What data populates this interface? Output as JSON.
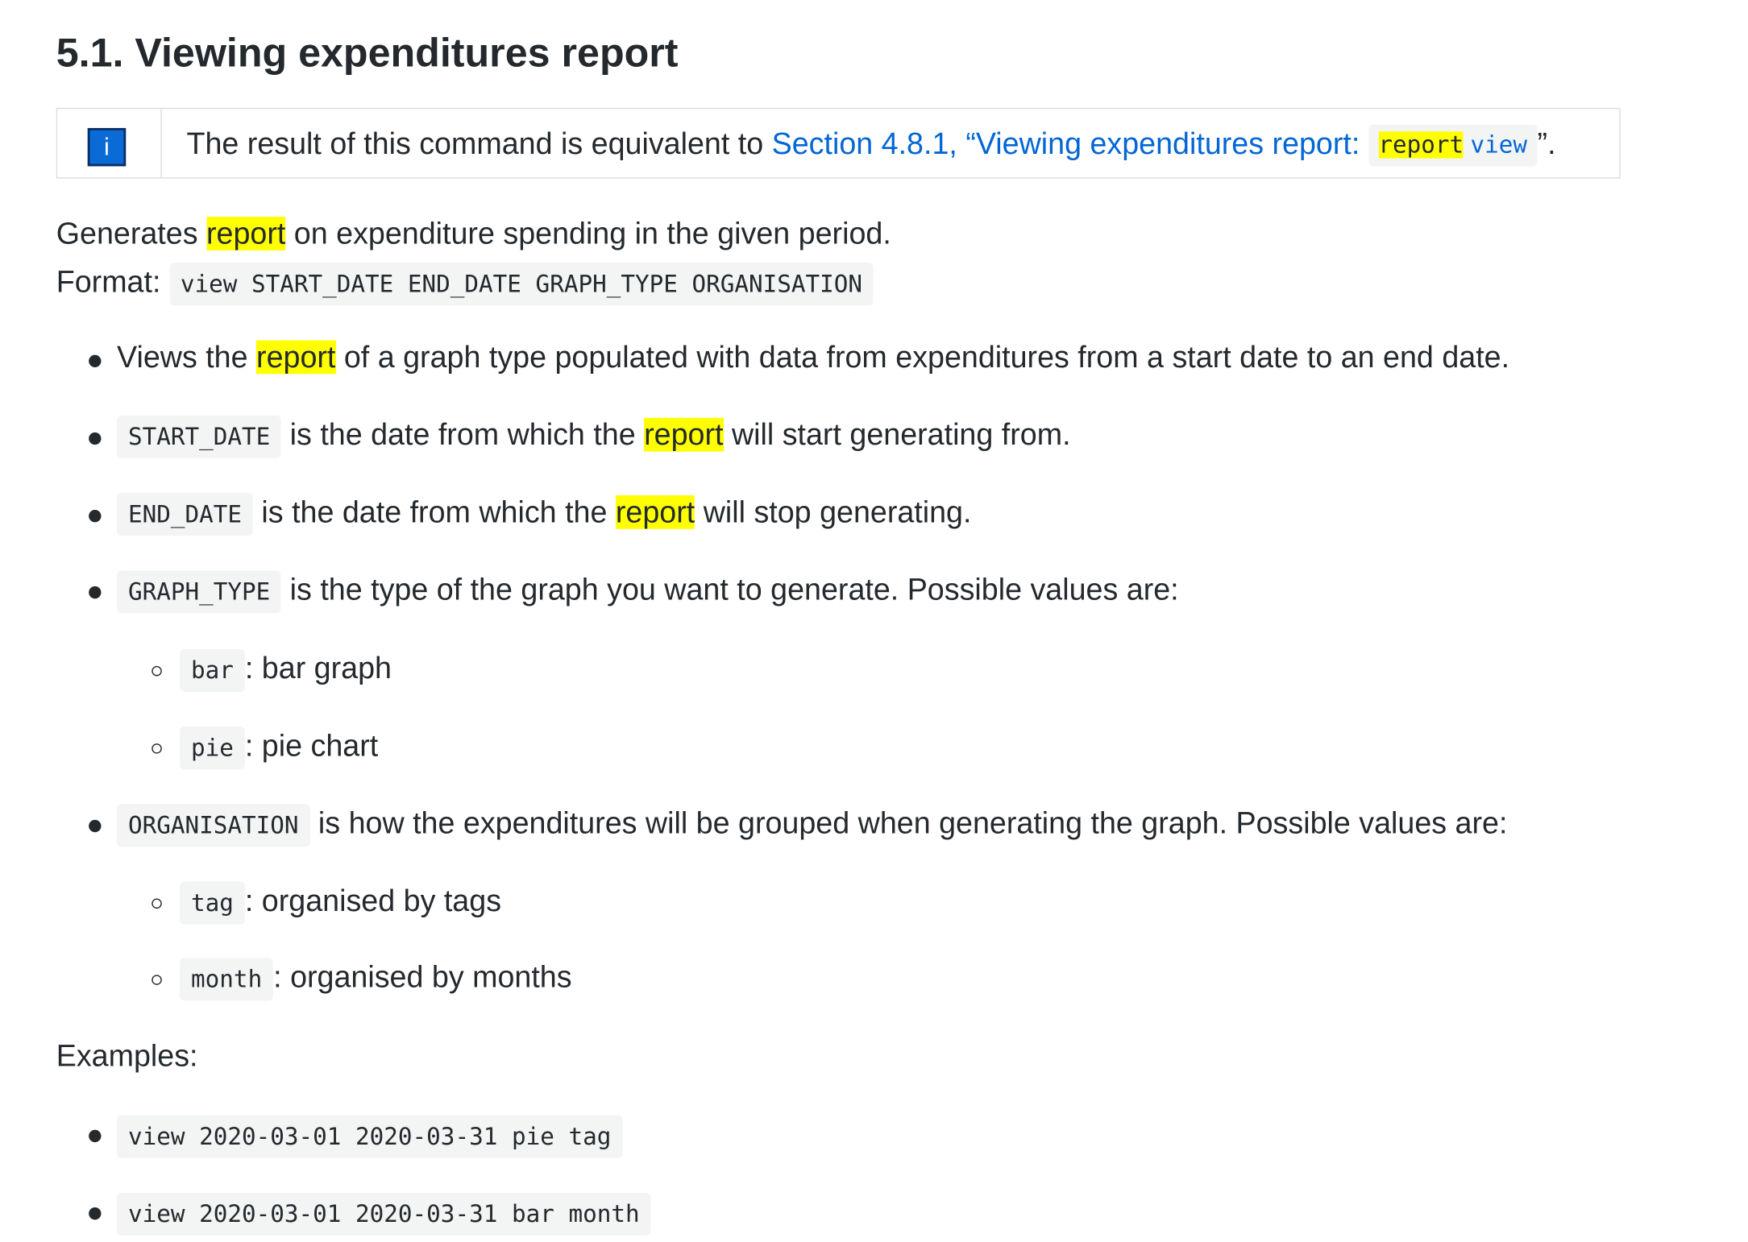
{
  "section": {
    "title": "5.1. Viewing expenditures report"
  },
  "admonition": {
    "icon_label": "i",
    "text_prefix": "The result of this command is equivalent to ",
    "link_text": "Section 4.8.1, “Viewing expenditures report: ",
    "code_report": "report",
    "code_view": "view",
    "text_suffix": "”."
  },
  "intro": {
    "generates_before": "Generates ",
    "highlight": "report",
    "generates_after": " on expenditure spending in the given period.",
    "format_label": "Format: ",
    "format_code": "view START_DATE END_DATE GRAPH_TYPE ORGANISATION"
  },
  "bullets": {
    "b1_before": "Views the ",
    "b1_highlight": "report",
    "b1_after": " of a graph type populated with data from expenditures from a start date to an end date.",
    "b2_code": "START_DATE",
    "b2_before": " is the date from which the ",
    "b2_highlight": "report",
    "b2_after": " will start generating from.",
    "b3_code": "END_DATE",
    "b3_before": " is the date from which the ",
    "b3_highlight": "report",
    "b3_after": " will stop generating.",
    "b4_code": "GRAPH_TYPE",
    "b4_text": " is the type of the graph you want to generate. Possible values are:",
    "b4_sub1_code": "bar",
    "b4_sub1_text": ": bar graph",
    "b4_sub2_code": "pie",
    "b4_sub2_text": ": pie chart",
    "b5_code": "ORGANISATION",
    "b5_text": " is how the expenditures will be grouped when generating the graph. Possible values are:",
    "b5_sub1_code": "tag",
    "b5_sub1_text": ": organised by tags",
    "b5_sub2_code": "month",
    "b5_sub2_text": ": organised by months"
  },
  "examples": {
    "label": "Examples:",
    "items": [
      "view 2020-03-01 2020-03-31 pie tag",
      "view 2020-03-01 2020-03-31 bar month"
    ]
  },
  "colors": {
    "highlight": "#ffff00",
    "link": "#0366d6",
    "info_icon": "#0b6bd6",
    "code_bg": "#f3f4f4"
  }
}
